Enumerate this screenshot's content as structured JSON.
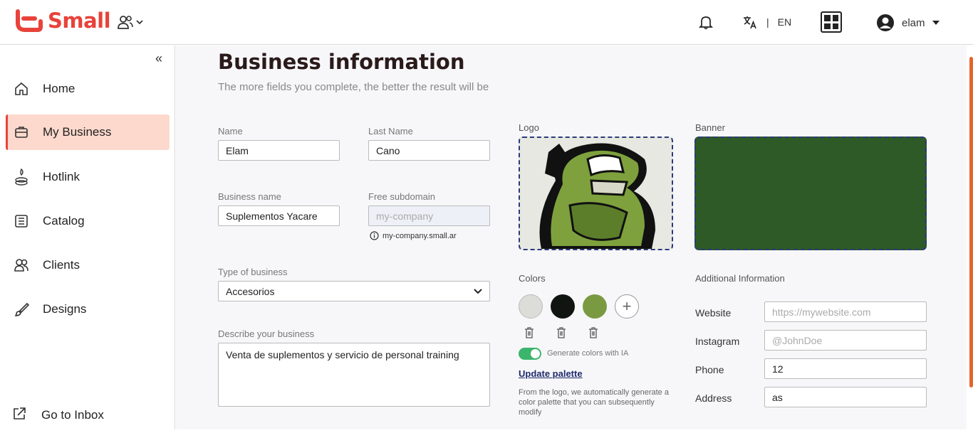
{
  "brand": {
    "name": "Small",
    "color": "#e8423a"
  },
  "topbar": {
    "lang_code": "EN",
    "user_name": "elam",
    "icons": [
      "team-icon",
      "bell-icon",
      "translate-icon",
      "apps-grid-icon",
      "user-avatar-icon"
    ]
  },
  "sidebar": {
    "items": [
      {
        "label": "Home",
        "icon": "home-icon"
      },
      {
        "label": "My Business",
        "icon": "briefcase-icon",
        "active": true
      },
      {
        "label": "Hotlink",
        "icon": "hotlink-icon"
      },
      {
        "label": "Catalog",
        "icon": "catalog-icon"
      },
      {
        "label": "Clients",
        "icon": "clients-icon"
      },
      {
        "label": "Designs",
        "icon": "brush-icon"
      }
    ],
    "footer_label": "Go to Inbox"
  },
  "main": {
    "title": "Business information",
    "subtitle": "The more fields you complete, the better the result will be",
    "form": {
      "name_label": "Name",
      "name_value": "Elam",
      "last_name_label": "Last Name",
      "last_name_value": "Cano",
      "business_name_label": "Business name",
      "business_name_value": "Suplementos Yacare",
      "subdomain_label": "Free subdomain",
      "subdomain_placeholder": "my-company",
      "subdomain_hint": "my-company.small.ar",
      "type_label": "Type of business",
      "type_value": "Accesorios",
      "describe_label": "Describe your business",
      "describe_value": "Venta de suplementos y servicio de personal training"
    },
    "media": {
      "logo_label": "Logo",
      "banner_label": "Banner",
      "banner_color": "#2d5a27"
    },
    "colors": {
      "label": "Colors",
      "swatches": [
        "#dcdcd8",
        "#111511",
        "#7a9a42"
      ],
      "toggle_label": "Generate colors with IA",
      "update_label": "Update palette",
      "description": "From the logo, we automatically generate a color palette that you can subsequently modify"
    },
    "additional": {
      "label": "Additional Information",
      "website_label": "Website",
      "website_placeholder": "https://mywebsite.com",
      "instagram_label": "Instagram",
      "instagram_placeholder": "@JohnDoe",
      "phone_label": "Phone",
      "phone_value": "12",
      "address_label": "Address",
      "address_value": "as"
    }
  }
}
